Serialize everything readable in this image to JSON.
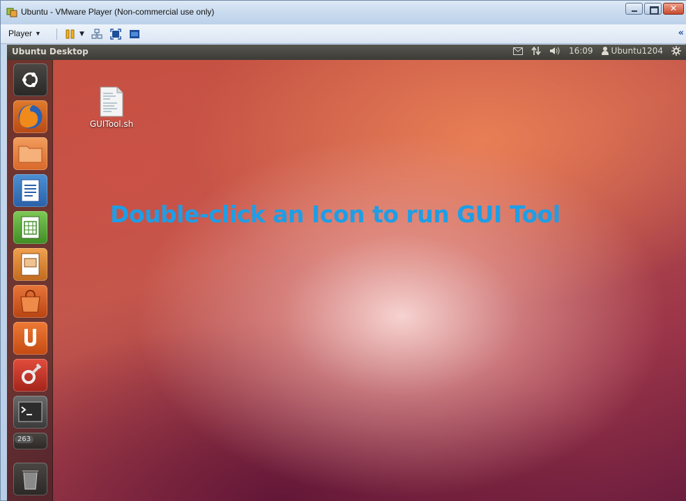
{
  "window": {
    "title": "Ubuntu - VMware Player (Non-commercial use only)",
    "icon": "vmware-icon"
  },
  "toolbar": {
    "player_label": "Player",
    "icons": [
      "pause-icon",
      "send-ctrl-alt-del-icon",
      "fullscreen-icon",
      "unity-icon"
    ],
    "collapse_icon": "double-chevron-left-icon"
  },
  "panel": {
    "title": "Ubuntu Desktop",
    "clock": "16:09",
    "user": "Ubuntu1204",
    "indicators": [
      "mail-icon",
      "network-icon",
      "volume-icon",
      "session-gear-icon"
    ]
  },
  "launcher": {
    "items": [
      {
        "name": "dash-home",
        "icon": "ubuntu-logo-icon"
      },
      {
        "name": "firefox",
        "icon": "firefox-icon"
      },
      {
        "name": "files",
        "icon": "folder-icon"
      },
      {
        "name": "libreoffice-writer",
        "icon": "writer-icon"
      },
      {
        "name": "libreoffice-calc",
        "icon": "calc-icon"
      },
      {
        "name": "libreoffice-impress",
        "icon": "impress-icon"
      },
      {
        "name": "software-center",
        "icon": "shopping-bag-icon"
      },
      {
        "name": "ubuntu-one",
        "icon": "ubuntu-one-icon"
      },
      {
        "name": "system-settings",
        "icon": "settings-wrench-icon"
      },
      {
        "name": "terminal",
        "icon": "terminal-icon"
      },
      {
        "name": "workspace-switcher",
        "icon": "workspace-icon",
        "badge": "263"
      },
      {
        "name": "trash",
        "icon": "trash-icon"
      }
    ]
  },
  "desktop": {
    "file": {
      "label": "GUITool.sh",
      "icon": "shell-script-file-icon"
    },
    "overlay": "Double-click an Icon to run GUI Tool"
  },
  "colors": {
    "overlay_text": "#1e9ee6",
    "panel": "#3c3b37",
    "ubuntu_orange": "#dd4814"
  }
}
